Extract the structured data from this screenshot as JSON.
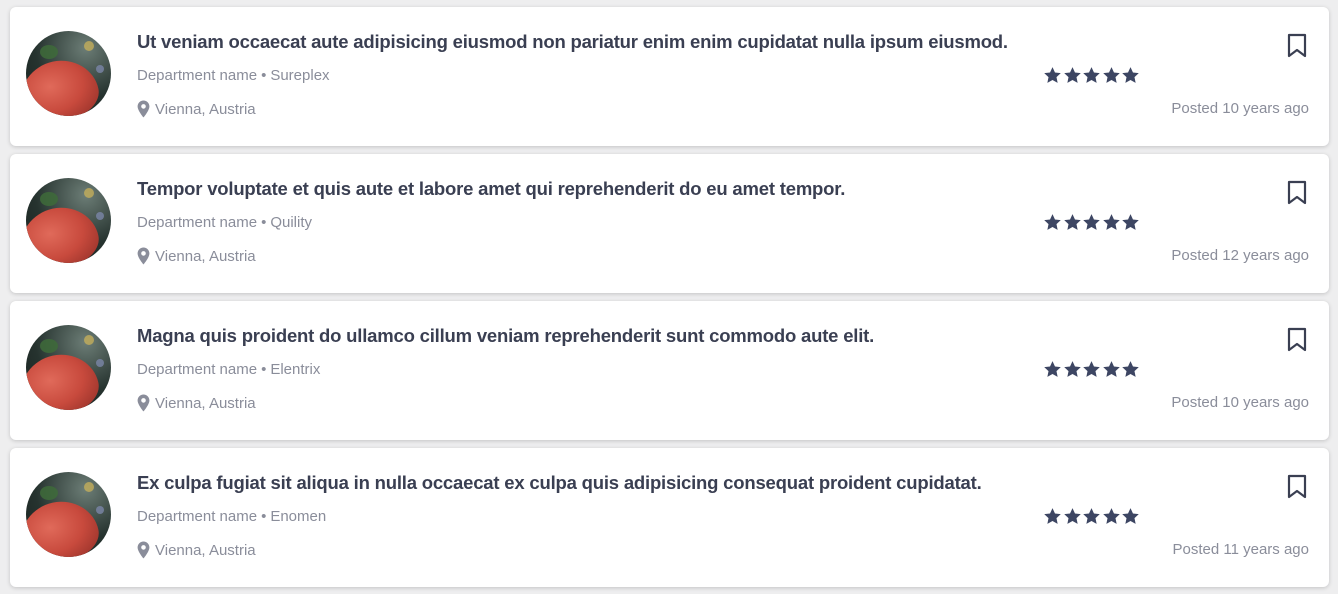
{
  "colors": {
    "title": "#3a3f52",
    "muted": "#8a8d9a",
    "star": "#3d4663",
    "background": "#eeeeef",
    "card": "#ffffff"
  },
  "jobs": [
    {
      "title": "Ut veniam occaecat aute adipisicing eiusmod non pariatur enim enim cupidatat nulla ipsum eiusmod.",
      "department": "Department name",
      "separator": "•",
      "company": "Sureplex",
      "location": "Vienna, Austria",
      "rating": 5,
      "posted": "Posted 10 years ago",
      "icons": {
        "location": "map-pin-icon",
        "bookmark": "bookmark-icon",
        "star": "star-icon"
      }
    },
    {
      "title": "Tempor voluptate et quis aute et labore amet qui reprehenderit do eu amet tempor.",
      "department": "Department name",
      "separator": "•",
      "company": "Quility",
      "location": "Vienna, Austria",
      "rating": 5,
      "posted": "Posted 12 years ago",
      "icons": {
        "location": "map-pin-icon",
        "bookmark": "bookmark-icon",
        "star": "star-icon"
      }
    },
    {
      "title": "Magna quis proident do ullamco cillum veniam reprehenderit sunt commodo aute elit.",
      "department": "Department name",
      "separator": "•",
      "company": "Elentrix",
      "location": "Vienna, Austria",
      "rating": 5,
      "posted": "Posted 10 years ago",
      "icons": {
        "location": "map-pin-icon",
        "bookmark": "bookmark-icon",
        "star": "star-icon"
      }
    },
    {
      "title": "Ex culpa fugiat sit aliqua in nulla occaecat ex culpa quis adipisicing consequat proident cupidatat.",
      "department": "Department name",
      "separator": "•",
      "company": "Enomen",
      "location": "Vienna, Austria",
      "rating": 5,
      "posted": "Posted 11 years ago",
      "icons": {
        "location": "map-pin-icon",
        "bookmark": "bookmark-icon",
        "star": "star-icon"
      }
    }
  ]
}
